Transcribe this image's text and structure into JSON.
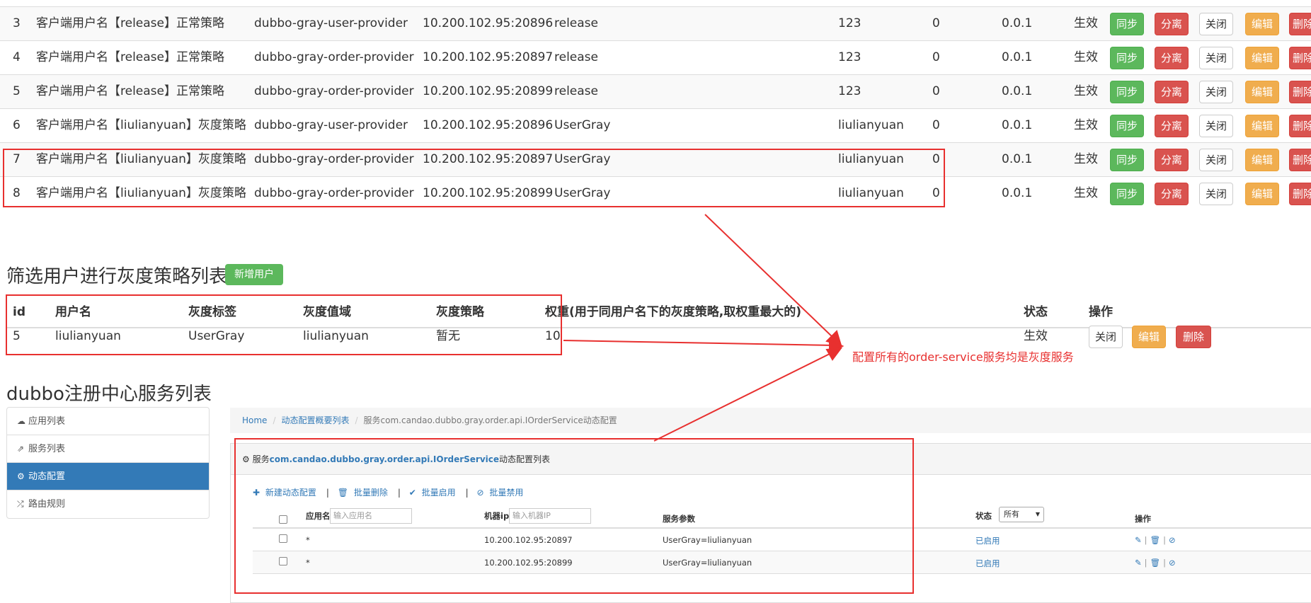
{
  "strategy_rows": [
    {
      "id": "3",
      "name": "客户端用户名【release】正常策略",
      "app": "dubbo-gray-user-provider",
      "ip": "10.200.102.95:20896",
      "version": "release",
      "tag": "123",
      "weight": "0",
      "v": "0.0.1",
      "status": "生效"
    },
    {
      "id": "4",
      "name": "客户端用户名【release】正常策略",
      "app": "dubbo-gray-order-provider",
      "ip": "10.200.102.95:20897",
      "version": "release",
      "tag": "123",
      "weight": "0",
      "v": "0.0.1",
      "status": "生效"
    },
    {
      "id": "5",
      "name": "客户端用户名【release】正常策略",
      "app": "dubbo-gray-order-provider",
      "ip": "10.200.102.95:20899",
      "version": "release",
      "tag": "123",
      "weight": "0",
      "v": "0.0.1",
      "status": "生效"
    },
    {
      "id": "6",
      "name": "客户端用户名【liulianyuan】灰度策略",
      "app": "dubbo-gray-user-provider",
      "ip": "10.200.102.95:20896",
      "version": "UserGray",
      "tag": "liulianyuan",
      "weight": "0",
      "v": "0.0.1",
      "status": "生效"
    },
    {
      "id": "7",
      "name": "客户端用户名【liulianyuan】灰度策略",
      "app": "dubbo-gray-order-provider",
      "ip": "10.200.102.95:20897",
      "version": "UserGray",
      "tag": "liulianyuan",
      "weight": "0",
      "v": "0.0.1",
      "status": "生效"
    },
    {
      "id": "8",
      "name": "客户端用户名【liulianyuan】灰度策略",
      "app": "dubbo-gray-order-provider",
      "ip": "10.200.102.95:20899",
      "version": "UserGray",
      "tag": "liulianyuan",
      "weight": "0",
      "v": "0.0.1",
      "status": "生效"
    }
  ],
  "row_actions": {
    "sync": "同步",
    "detach": "分离",
    "close": "关闭",
    "edit": "编辑",
    "delete": "删除"
  },
  "filter_section": {
    "title": "筛选用户进行灰度策略列表",
    "add_button": "新增用户",
    "headers": {
      "id": "id",
      "user": "用户名",
      "tag": "灰度标签",
      "value": "灰度值域",
      "policy": "灰度策略",
      "weight": "权重(用于同用户名下的灰度策略,取权重最大的)",
      "status": "状态",
      "ops": "操作"
    },
    "row": {
      "id": "5",
      "user": "liulianyuan",
      "tag": "UserGray",
      "value": "liulianyuan",
      "policy": "暂无",
      "weight": "10",
      "status": "生效"
    },
    "actions": {
      "close": "关闭",
      "edit": "编辑",
      "delete": "删除"
    }
  },
  "annotation": "配置所有的order-service服务均是灰度服务",
  "dubbo_section": {
    "title": "dubbo注册中心服务列表",
    "sidebar": [
      {
        "label": "应用列表",
        "icon": "cloud-icon"
      },
      {
        "label": "服务列表",
        "icon": "share-icon"
      },
      {
        "label": "动态配置",
        "icon": "cogs-icon"
      },
      {
        "label": "路由规则",
        "icon": "random-icon"
      }
    ],
    "breadcrumb": {
      "home": "Home",
      "list": "动态配置概要列表",
      "current": "服务com.candao.dubbo.gray.order.api.IOrderService动态配置"
    },
    "panel_title": {
      "prefix": "服务",
      "service": "com.candao.dubbo.gray.order.api.IOrderService",
      "suffix": "动态配置列表"
    },
    "toolbar": {
      "new": "新建动态配置",
      "batch_delete": "批量删除",
      "batch_enable": "批量启用",
      "batch_disable": "批量禁用"
    },
    "table_headers": {
      "app": "应用名",
      "app_placeholder": "输入应用名",
      "ip": "机器ip",
      "ip_placeholder": "输入机器IP",
      "params": "服务参数",
      "status": "状态",
      "status_option": "所有",
      "ops": "操作"
    },
    "table_rows": [
      {
        "app": "*",
        "ip": "10.200.102.95:20897",
        "params": "UserGray=liulianyuan",
        "status": "已启用"
      },
      {
        "app": "*",
        "ip": "10.200.102.95:20899",
        "params": "UserGray=liulianyuan",
        "status": "已启用"
      }
    ]
  },
  "colors": {
    "highlight": "#e8302f",
    "green": "#5cb85c",
    "red": "#d9534f",
    "orange": "#f0ad4e",
    "blue": "#337ab7"
  }
}
